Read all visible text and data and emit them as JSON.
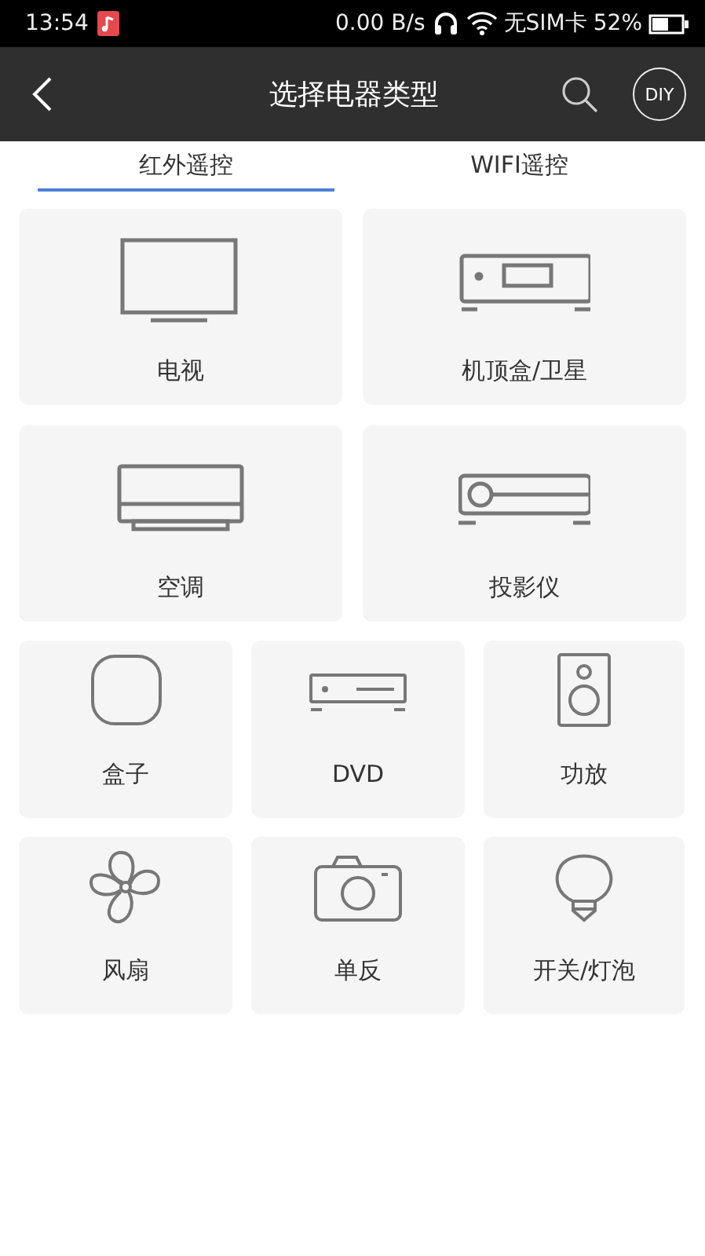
{
  "status_bar": {
    "time": "13:54",
    "speed": "0.00 B/s",
    "sim": "无SIM卡",
    "battery": "52%"
  },
  "header": {
    "title": "选择电器类型",
    "diy": "DIY"
  },
  "tabs": [
    {
      "label": "红外遥控",
      "selected": true
    },
    {
      "label": "WIFI遥控",
      "selected": false
    }
  ],
  "large_devices": [
    {
      "kind": "tv",
      "label": "电视"
    },
    {
      "kind": "stb",
      "label": "机顶盒/卫星"
    },
    {
      "kind": "ac",
      "label": "空调"
    },
    {
      "kind": "projector",
      "label": "投影仪"
    }
  ],
  "small_devices": [
    {
      "kind": "box",
      "label": "盒子"
    },
    {
      "kind": "dvd",
      "label": "DVD"
    },
    {
      "kind": "speaker",
      "label": "功放"
    },
    {
      "kind": "fan",
      "label": "风扇"
    },
    {
      "kind": "camera",
      "label": "单反"
    },
    {
      "kind": "bulb",
      "label": "开关/灯泡"
    }
  ]
}
